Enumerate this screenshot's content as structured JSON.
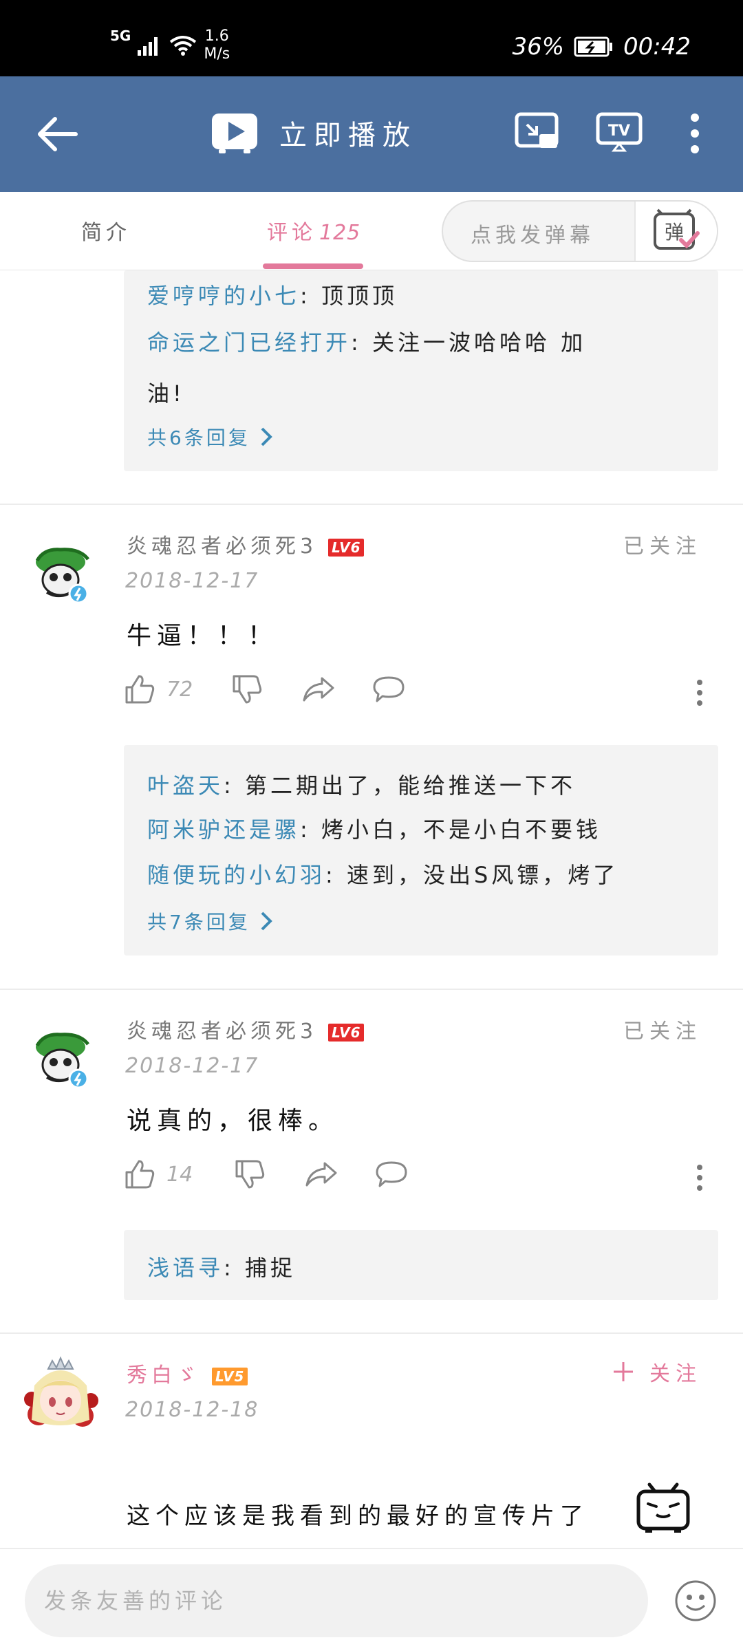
{
  "status_bar": {
    "network": "5G",
    "speed_value": "1.6",
    "speed_unit": "M/s",
    "battery": "36%",
    "time": "00:42"
  },
  "header": {
    "play_label": "立即播放"
  },
  "tabs": [
    {
      "label": "简介"
    },
    {
      "label": "评论",
      "count": "125"
    }
  ],
  "danmaku": {
    "placeholder": "点我发弹幕",
    "icon_text": "弹"
  },
  "top_reply_box": {
    "lines": [
      {
        "user": "爱哼哼的小七",
        "text": ": 顶顶顶"
      },
      {
        "user": "命运之门已经打开",
        "text": ": 关注一波哈哈哈 加"
      },
      {
        "user": "",
        "text": "油!"
      }
    ],
    "more": "共6条回复"
  },
  "comments": [
    {
      "username": "炎魂忍者必须死3",
      "level": "LV6",
      "follow": "已关注",
      "date": "2018-12-17",
      "text": "牛逼！！！",
      "likes": "72",
      "replies": [
        {
          "user": "叶盗天",
          "text": ": 第二期出了，能给推送一下不"
        },
        {
          "user": "阿米驴还是骡",
          "text": ": 烤小白，不是小白不要钱"
        },
        {
          "user": "随便玩的小幻羽",
          "text": ": 速到，没出S风镖，烤了"
        }
      ],
      "more": "共7条回复"
    },
    {
      "username": "炎魂忍者必须死3",
      "level": "LV6",
      "follow": "已关注",
      "date": "2018-12-17",
      "text": "说真的，很棒。",
      "likes": "14",
      "replies": [
        {
          "user": "浅语寻",
          "text": ": 捕捉"
        }
      ]
    },
    {
      "username": "秀白ゞ",
      "level": "LV5",
      "follow": "关注",
      "date": "2018-12-18",
      "text": "这个应该是我看到的最好的宣传片了"
    }
  ],
  "bottom_bar": {
    "placeholder": "发条友善的评论"
  },
  "colors": {
    "header_bg": "#4b6f9f",
    "accent_pink": "#e3799b",
    "reply_user_blue": "#3b89b5",
    "lv6": "#e52b2b",
    "lv5": "#ff9a2e"
  }
}
